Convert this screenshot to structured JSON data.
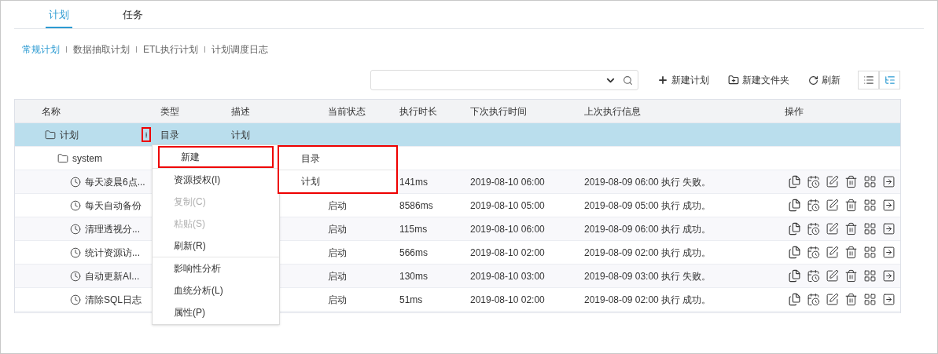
{
  "tabs": [
    {
      "label": "计划",
      "selected": true
    },
    {
      "label": "任务",
      "selected": false
    }
  ],
  "subnav": [
    {
      "label": "常规计划",
      "selected": true
    },
    {
      "label": "数据抽取计划",
      "selected": false
    },
    {
      "label": "ETL执行计划",
      "selected": false
    },
    {
      "label": "计划调度日志",
      "selected": false
    }
  ],
  "toolbar": {
    "buttons": [
      {
        "kind": "plus",
        "label": "新建计划"
      },
      {
        "kind": "folder",
        "label": "新建文件夹"
      },
      {
        "kind": "refresh",
        "label": "刷新"
      }
    ],
    "views": [
      {
        "kind": "list",
        "selected": false
      },
      {
        "kind": "tree",
        "selected": true
      }
    ]
  },
  "table": {
    "columns": [
      "名称",
      "类型",
      "描述",
      "当前状态",
      "执行时长",
      "下次执行时间",
      "上次执行信息",
      "操作"
    ],
    "rows": [
      {
        "kind": "folder",
        "name": "计划",
        "type": "目录",
        "desc": "计划",
        "selected": true,
        "menu_open": true,
        "children": [
          {
            "kind": "folder",
            "name": "system",
            "selected": false,
            "children": [
              {
                "kind": "schedule",
                "name": "每天凌晨6点...",
                "duration": "141ms",
                "next": "2019-08-10 06:00",
                "last": "2019-08-09 06:00 执行 失败。",
                "selected": false
              },
              {
                "kind": "schedule",
                "name": "每天自动备份",
                "status": "启动",
                "duration": "8586ms",
                "next": "2019-08-10 05:00",
                "last": "2019-08-09 05:00 执行 成功。",
                "selected": false
              },
              {
                "kind": "schedule",
                "name": "清理透视分...",
                "status": "启动",
                "duration": "115ms",
                "next": "2019-08-10 06:00",
                "last": "2019-08-09 06:00 执行 成功。",
                "selected": false
              },
              {
                "kind": "schedule",
                "name": "统计资源访...",
                "status": "启动",
                "duration": "566ms",
                "next": "2019-08-10 02:00",
                "last": "2019-08-09 02:00 执行 成功。",
                "selected": false
              },
              {
                "kind": "schedule",
                "name": "自动更新AI...",
                "status": "启动",
                "duration": "130ms",
                "next": "2019-08-10 03:00",
                "last": "2019-08-09 03:00 执行 失败。",
                "selected": false
              },
              {
                "kind": "schedule",
                "name": "清除SQL日志",
                "status": "启动",
                "duration": "51ms",
                "next": "2019-08-10 02:00",
                "last": "2019-08-09 02:00 执行 成功。",
                "selected": false
              }
            ]
          }
        ]
      }
    ]
  },
  "context_menu": {
    "groups": [
      [
        {
          "label": "新建",
          "disabled": false,
          "highlighted": true,
          "has_submenu": true
        }
      ],
      [
        {
          "label": "资源授权(I)",
          "disabled": false,
          "highlighted": false,
          "has_submenu": false
        },
        {
          "label": "复制(C)",
          "disabled": true,
          "highlighted": false,
          "has_submenu": false
        },
        {
          "label": "粘贴(S)",
          "disabled": true,
          "highlighted": false,
          "has_submenu": false
        },
        {
          "label": "刷新(R)",
          "disabled": false,
          "highlighted": false,
          "has_submenu": false
        }
      ],
      [
        {
          "label": "影响性分析",
          "disabled": false,
          "highlighted": false,
          "has_submenu": false
        },
        {
          "label": "血统分析(L)",
          "disabled": false,
          "highlighted": false,
          "has_submenu": false
        },
        {
          "label": "属性(P)",
          "disabled": false,
          "highlighted": false,
          "has_submenu": false
        }
      ]
    ],
    "submenu": {
      "highlighted": true,
      "items": [
        "目录",
        "计划"
      ]
    }
  }
}
